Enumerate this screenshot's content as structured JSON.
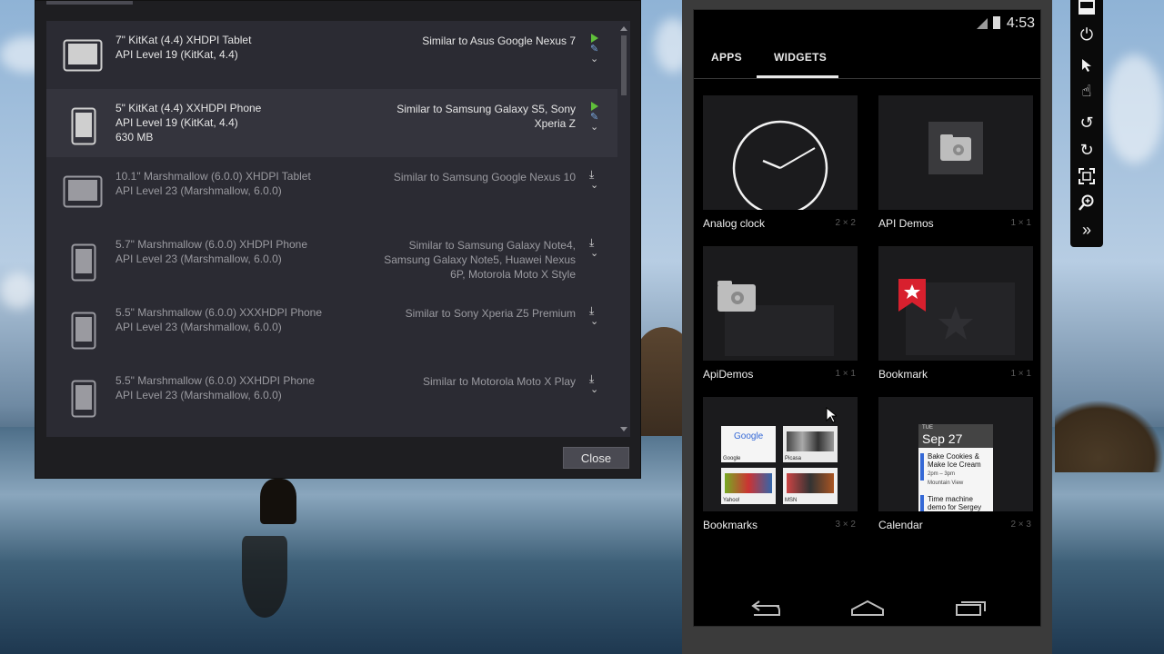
{
  "device_list": {
    "rows": [
      {
        "name": "7\" KitKat (4.4) XHDPI Tablet",
        "api": "API Level 19 (KitKat, 4.4)",
        "size": "",
        "similar": "Similar to Asus Google Nexus 7",
        "type": "tablet",
        "installed": true
      },
      {
        "name": "5\" KitKat (4.4) XXHDPI Phone",
        "api": "API Level 19 (KitKat, 4.4)",
        "size": "630 MB",
        "similar": "Similar to Samsung Galaxy S5, Sony Xperia Z",
        "type": "phone",
        "installed": true
      },
      {
        "name": "10.1\" Marshmallow (6.0.0) XHDPI Tablet",
        "api": "API Level 23 (Marshmallow, 6.0.0)",
        "size": "",
        "similar": "Similar to Samsung Google Nexus 10",
        "type": "tablet",
        "installed": false
      },
      {
        "name": "5.7\" Marshmallow (6.0.0) XHDPI Phone",
        "api": "API Level 23 (Marshmallow, 6.0.0)",
        "size": "",
        "similar": "Similar to Samsung Galaxy Note4, Samsung Galaxy Note5, Huawei Nexus 6P, Motorola Moto X Style",
        "type": "phone",
        "installed": false
      },
      {
        "name": "5.5\" Marshmallow (6.0.0) XXXHDPI Phone",
        "api": "API Level 23 (Marshmallow, 6.0.0)",
        "size": "",
        "similar": "Similar to Sony Xperia Z5 Premium",
        "type": "phone",
        "installed": false
      },
      {
        "name": "5.5\" Marshmallow (6.0.0) XXHDPI Phone",
        "api": "API Level 23 (Marshmallow, 6.0.0)",
        "size": "",
        "similar": "Similar to Motorola Moto X Play",
        "type": "phone",
        "installed": false
      }
    ],
    "close_label": "Close"
  },
  "emulator": {
    "status_time": "4:53",
    "tabs": [
      "APPS",
      "WIDGETS"
    ],
    "active_tab": "WIDGETS",
    "widgets": [
      {
        "label": "Analog clock",
        "size": "2 × 2"
      },
      {
        "label": "API Demos",
        "size": "1 × 1"
      },
      {
        "label": "ApiDemos",
        "size": "1 × 1"
      },
      {
        "label": "Bookmark",
        "size": "1 × 1"
      },
      {
        "label": "Bookmarks",
        "size": "3 × 2"
      },
      {
        "label": "Calendar",
        "size": "2 × 3"
      }
    ],
    "bookmarks_thumbs": [
      "Google",
      "Picasa",
      "Yahoo!",
      "MSN"
    ],
    "calendar": {
      "dow": "TUE",
      "date": "Sep 27",
      "event1": "Bake Cookies & Make Ice Cream",
      "event1_time": "2pm – 3pm",
      "event1_place": "Mountain View",
      "event2": "Time machine demo for Sergey"
    }
  },
  "toolbar_icons": [
    "minimize-icon",
    "power-icon",
    "pointer-icon",
    "touch-icon",
    "rotate-left-icon",
    "rotate-right-icon",
    "fit-screen-icon",
    "zoom-icon",
    "more-icon"
  ],
  "colors": {
    "play_green": "#5fbf3a",
    "dialog_bg": "#2b2b33",
    "bookmark_red": "#d8202e"
  }
}
